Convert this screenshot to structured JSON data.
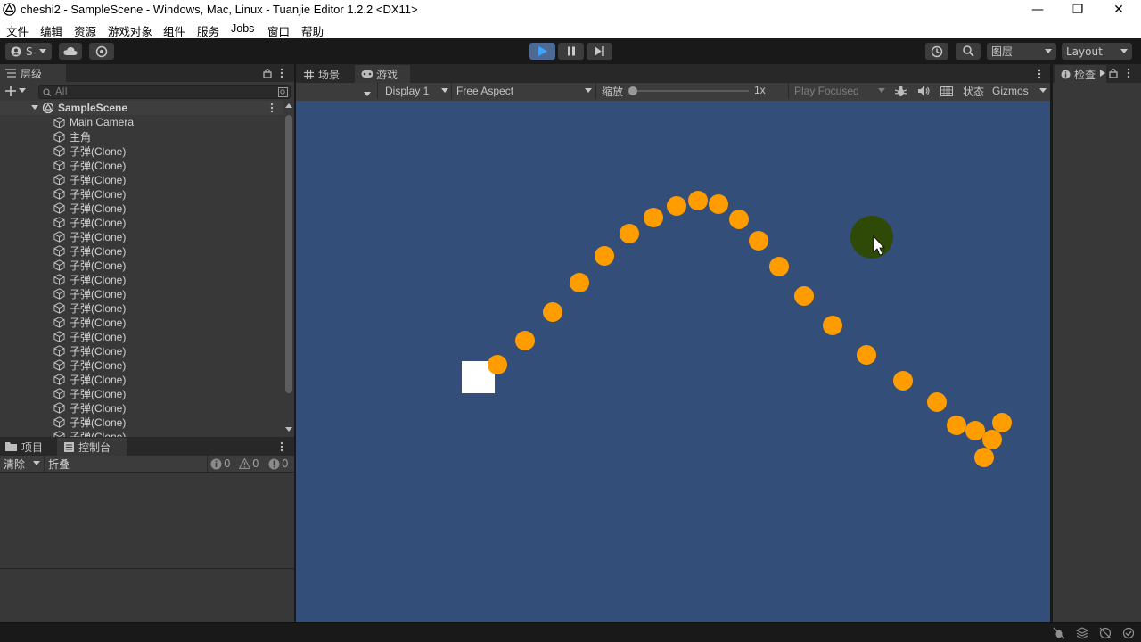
{
  "window": {
    "title": "cheshi2 - SampleScene - Windows, Mac, Linux - Tuanjie Editor 1.2.2 <DX11>",
    "minimize": "—",
    "maximize": "❐",
    "close": "✕"
  },
  "menu": [
    "文件",
    "编辑",
    "资源",
    "游戏对象",
    "组件",
    "服务",
    "Jobs",
    "窗口",
    "帮助"
  ],
  "toolbar": {
    "account_label": "S",
    "layers_label": "图层",
    "layout_label": "Layout"
  },
  "hierarchy": {
    "tab_label": "层级",
    "search_placeholder": "All",
    "scene_name": "SampleScene",
    "items": [
      "Main Camera",
      "主角",
      "子弹(Clone)",
      "子弹(Clone)",
      "子弹(Clone)",
      "子弹(Clone)",
      "子弹(Clone)",
      "子弹(Clone)",
      "子弹(Clone)",
      "子弹(Clone)",
      "子弹(Clone)",
      "子弹(Clone)",
      "子弹(Clone)",
      "子弹(Clone)",
      "子弹(Clone)",
      "子弹(Clone)",
      "子弹(Clone)",
      "子弹(Clone)",
      "子弹(Clone)",
      "子弹(Clone)",
      "子弹(Clone)",
      "子弹(Clone)",
      "子弹(Clone)"
    ]
  },
  "console": {
    "tab_project": "项目",
    "tab_console": "控制台",
    "clear_label": "清除",
    "collapse_label": "折叠",
    "info_count": "0",
    "warn_count": "0",
    "error_count": "0"
  },
  "game_view": {
    "tab_scene": "场景",
    "tab_game": "游戏",
    "display": "Display 1",
    "aspect": "Free Aspect",
    "scale_label": "缩放",
    "scale_value": "1x",
    "play_mode": "Play Focused",
    "stats_label": "状态",
    "gizmos_label": "Gizmos",
    "background_color": "#344e7a",
    "bullet_color": "#ff9d00",
    "enemy_color": "#2f4a06"
  },
  "inspector": {
    "tab_label": "检查"
  }
}
